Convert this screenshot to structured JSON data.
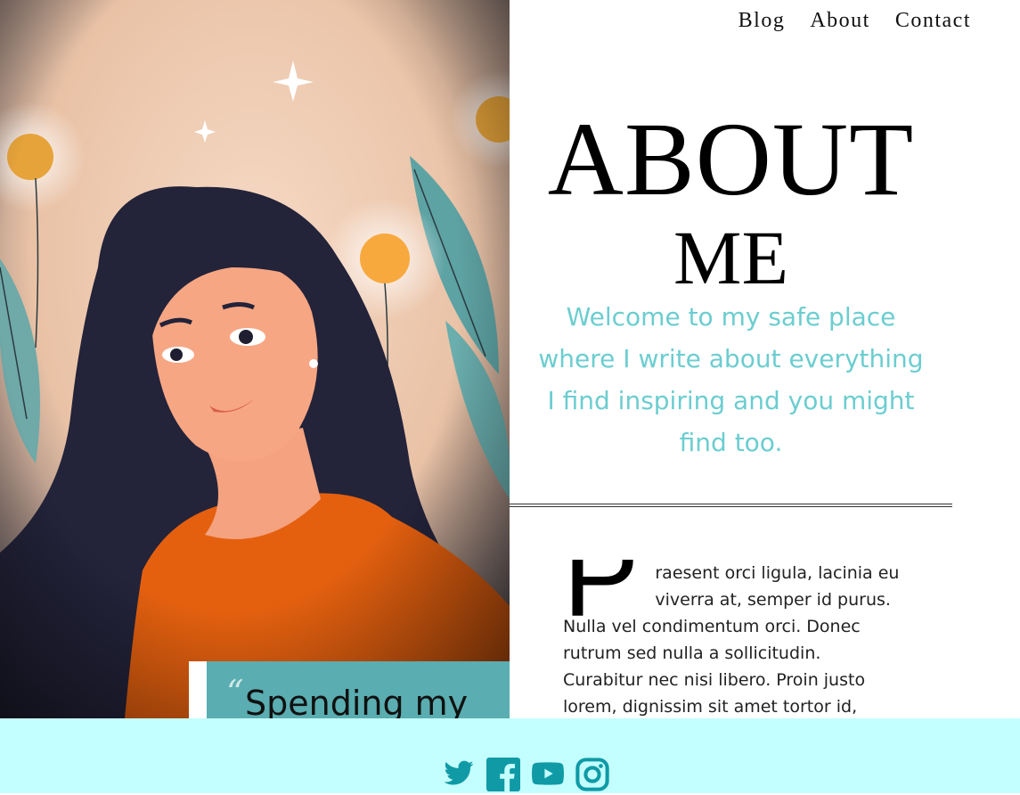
{
  "nav": {
    "items": [
      "Blog",
      "About",
      "Contact"
    ]
  },
  "hero": {
    "quote_mark": "“",
    "quote_text": "Spending my"
  },
  "title": {
    "line1": "ABOUT",
    "line2": "ME"
  },
  "tagline": "Welcome to my safe place where I write about everything I find inspiring and you might find too.",
  "body": {
    "dropcap": "P",
    "text": "raesent orci ligula, lacinia eu viverra at, semper id purus. Nulla vel condimentum orci. Donec rutrum sed nulla a sollicitudin. Curabitur nec nisi libero. Proin justo lorem, dignissim sit amet tortor id, sagittis"
  },
  "footer": {
    "social_icons": [
      "twitter-icon",
      "facebook-icon",
      "youtube-icon",
      "instagram-icon"
    ]
  },
  "colors": {
    "accent": "#6ccdd0",
    "footer_bg": "#c4ffff",
    "quote_bg": "#5aadb0",
    "icon": "#0f9aa6"
  }
}
